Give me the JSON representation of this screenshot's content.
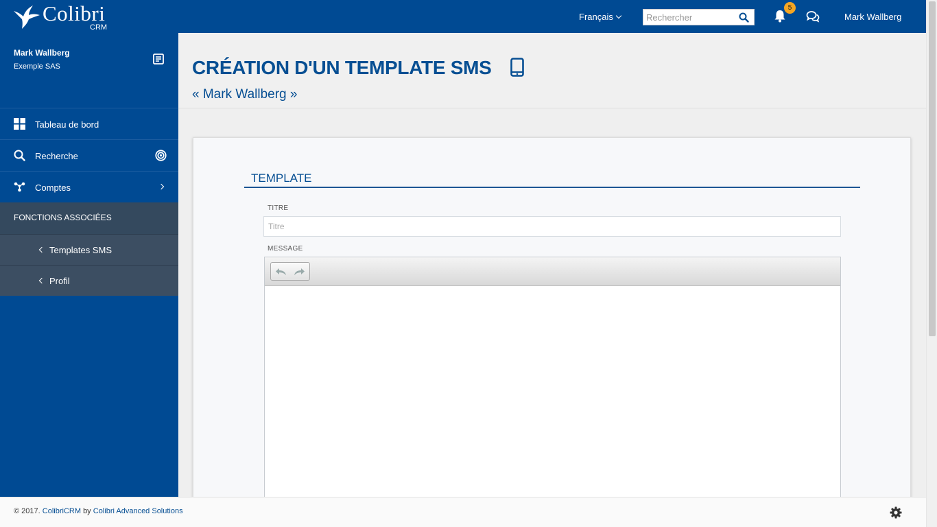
{
  "header": {
    "brand": "Colibri",
    "brand_sub": "CRM",
    "language": "Français",
    "search_placeholder": "Rechercher",
    "notification_count": "5",
    "user": "Mark Wallberg"
  },
  "sidebar": {
    "profile_name": "Mark Wallberg",
    "profile_company": "Exemple SAS",
    "nav": [
      {
        "label": "Tableau de bord",
        "icon": "grid-icon"
      },
      {
        "label": "Recherche",
        "icon": "search-icon"
      },
      {
        "label": "Comptes",
        "icon": "network-icon"
      }
    ],
    "functions_header": "FONCTIONS ASSOCIÉES",
    "sub_items": [
      {
        "label": "Templates SMS"
      },
      {
        "label": "Profil"
      }
    ]
  },
  "page": {
    "title": "CRÉATION D'UN TEMPLATE SMS",
    "subtitle": "« Mark Wallberg »"
  },
  "form": {
    "section_title": "TEMPLATE",
    "title_label": "TITRE",
    "title_placeholder": "Titre",
    "title_value": "",
    "message_label": "MESSAGE"
  },
  "footer": {
    "copyright": "© 2017.",
    "product": "ColibriCRM",
    "by": "by",
    "company": "Colibri Advanced Solutions"
  },
  "colors": {
    "primary": "#004a93",
    "heading": "#074f93",
    "functions_bg": "#34495e",
    "badge": "#f5a623"
  }
}
